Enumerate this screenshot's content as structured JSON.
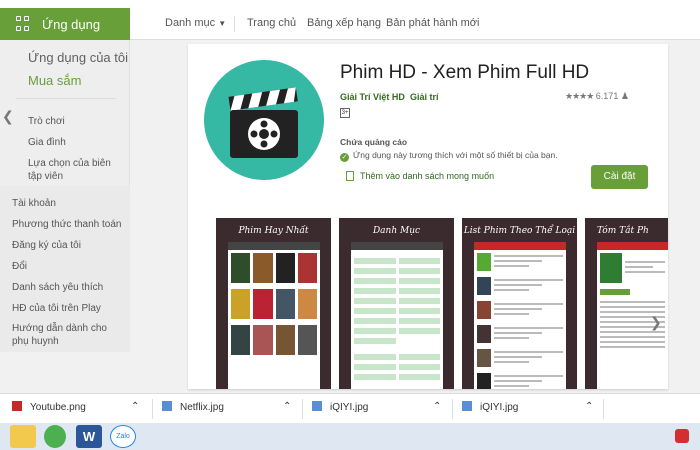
{
  "header": {
    "apps_label": "Ứng dụng",
    "nav": [
      "Danh mục",
      "Trang chủ",
      "Bảng xếp hạng",
      "Bản phát hành mới"
    ]
  },
  "sidebar": {
    "main": [
      "Ứng dụng của tôi",
      "Mua sắm"
    ],
    "categories": [
      "Trò chơi",
      "Gia đình",
      "Lựa chọn của biên tập viên"
    ],
    "account": [
      "Tài khoản",
      "Phương thức thanh toán",
      "Đăng ký của tôi",
      "Đổi",
      "Danh sách yêu thích",
      "HĐ của tôi trên Play",
      "Hướng dẫn dành cho phụ huynh"
    ]
  },
  "app": {
    "title": "Phim HD - Xem Phim Full HD",
    "developer": "Giải Trí Việt HD",
    "category": "Giải trí",
    "stars": "★★★★",
    "rating_count": "6.171",
    "age_badge": "3+",
    "ads_notice": "Chứa quảng cáo",
    "compat_notice": "Ứng dụng này tương thích với một số thiết bị của bạn.",
    "wishlist_label": "Thêm vào danh sách mong muốn",
    "install_label": "Cài đặt"
  },
  "screenshots": [
    {
      "caption": "Phim Hay Nhất"
    },
    {
      "caption": "Danh Mục"
    },
    {
      "caption": "List Phim Theo Thể Loại"
    },
    {
      "caption": "Tóm Tắt Ph"
    }
  ],
  "downloads": [
    "Youtube.png",
    "Netflix.jpg",
    "iQIYI.jpg",
    "iQIYI.jpg"
  ],
  "colors": {
    "brand_green": "#689f38",
    "icon_teal": "#35b8a4"
  }
}
